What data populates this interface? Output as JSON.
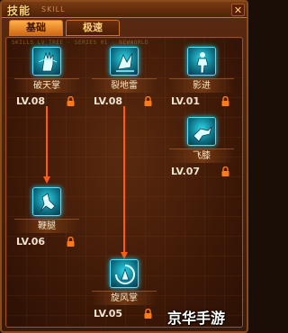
{
  "window": {
    "title": "技能",
    "subtitle": "SKILL",
    "close_label": "✕"
  },
  "tabs": [
    {
      "label": "基础",
      "active": true
    },
    {
      "label": "极速",
      "active": false
    }
  ],
  "panel_note": "SKILLS LV TREE · SERIES 01 · NEWWORLD",
  "skills": [
    {
      "name": "破天掌",
      "level": "LV.08",
      "icon": "palm-strike-icon",
      "locked": true
    },
    {
      "name": "裂地雷",
      "level": "LV.08",
      "icon": "ground-thunder-icon",
      "locked": true
    },
    {
      "name": "影进",
      "level": "LV.01",
      "icon": "shadow-advance-icon",
      "locked": true
    },
    {
      "name": "飞膝",
      "level": "LV.07",
      "icon": "flying-knee-icon",
      "locked": true
    },
    {
      "name": "鞭腿",
      "level": "LV.06",
      "icon": "whip-kick-icon",
      "locked": true
    },
    {
      "name": "旋风掌",
      "level": "LV.05",
      "icon": "whirlwind-palm-icon",
      "locked": true
    }
  ],
  "watermark": "京华手游",
  "colors": {
    "accent": "#24c8e8",
    "arrow": "#ff5a14",
    "lock": "#ff7a1a",
    "frame": "#8a4a1a"
  }
}
